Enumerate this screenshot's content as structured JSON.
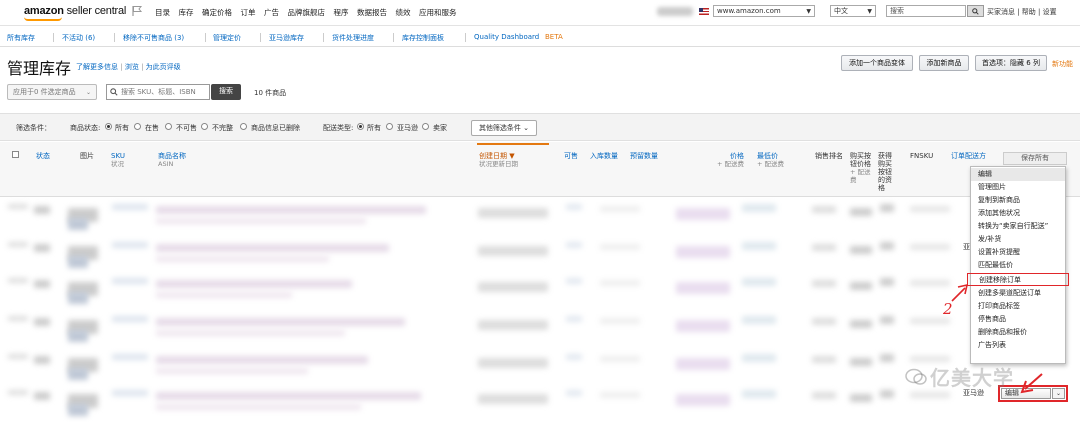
{
  "header": {
    "logo_main": "amazon",
    "logo_sub": " seller central",
    "nav": [
      "目录",
      "库存",
      "确定价格",
      "订单",
      "广告",
      "品牌旗舰店",
      "程序",
      "数据报告",
      "绩效",
      "应用和服务"
    ],
    "marketplace": "www.amazon.com",
    "language": "中文",
    "search_placeholder": "搜索",
    "links": "买家消息 | 帮助 | 设置"
  },
  "subnav": {
    "items": [
      "所有库存",
      "不活动 (6)",
      "移除不可售商品 (3)",
      "管理定价",
      "亚马逊库存",
      "货件处理进度",
      "库存控制面板",
      "Quality Dashboard"
    ],
    "beta": "BETA"
  },
  "page": {
    "title": "管理库存",
    "learn_more": "了解更多信息",
    "tour": "浏览",
    "rate": "为此页评级",
    "add_variation": "添加一个商品变体",
    "add_product": "添加新商品",
    "preferences": "首选项：隐藏 6 列",
    "new_feature": "新功能"
  },
  "toolbar": {
    "bulk_action": "应用于0 件选定商品",
    "search_placeholder": "搜索 SKU、标题、ISBN",
    "search_button": "搜索",
    "count": "10 件商品"
  },
  "filters": {
    "label": "筛选条件：",
    "status_label": "商品状态:",
    "status_options": [
      "所有",
      "在售",
      "不可售",
      "不完整",
      "商品信息已删除"
    ],
    "fulfillment_label": "配送类型:",
    "fulfillment_options": [
      "所有",
      "亚马逊",
      "卖家"
    ],
    "more_filters": "其他筛选条件"
  },
  "table": {
    "col_status": "状态",
    "col_image": "图片",
    "col_sku": "SKU",
    "col_sku_sub": "状况",
    "col_name": "商品名称",
    "col_name_sub": "ASIN",
    "col_created": "创建日期 ▼",
    "col_created_sub": "状况更新日期",
    "col_available": "可售",
    "col_inbound": "入库数量",
    "col_reserved": "预留数量",
    "col_price": "价格",
    "col_price_sub": "+ 配送费",
    "col_min_price": "最低价",
    "col_min_price_sub": "+ 配送费",
    "col_rank": "销售排名",
    "col_buybox_1": "购买按",
    "col_buybox_2": "钮价格",
    "col_buybox_3": "+ 配送",
    "col_buybox_4": "费",
    "col_eligible_1": "获得",
    "col_eligible_2": "购买",
    "col_eligible_3": "按钮",
    "col_eligible_4": "的资",
    "col_eligible_5": "格",
    "col_fnsku": "FNSKU",
    "col_fulfillment": "订单配送方",
    "save_all": "保存所有",
    "row_label_1": "亚马逊",
    "row_label_2": "亚马逊"
  },
  "menu": {
    "items": [
      "编辑",
      "管理图片",
      "复制到新商品",
      "添加其他状况",
      "转换为“卖家自行配送”",
      "发/补货",
      "设置补货提醒",
      "匹配最低价",
      "创建移除订单",
      "创建多渠道配送订单",
      "打印商品标签",
      "停售商品",
      "删除商品和报价",
      "广告列表"
    ]
  },
  "edit_dropdown": {
    "value": "编辑"
  },
  "annotation": {
    "step": "2"
  },
  "watermark": "亿美大学"
}
